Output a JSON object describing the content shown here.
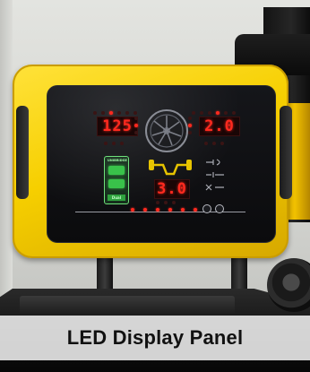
{
  "panel": {
    "readout_left": "125",
    "readout_right": "2.0",
    "readout_lower": "3.0",
    "module_top_label": "UNIBRIDGE",
    "module_bottom_label": "Dual"
  },
  "caption": {
    "text": "LED Display Panel"
  },
  "colors": {
    "housing": "#f6cf00",
    "screen": "#0b0b0d",
    "led_red": "#ff2a1f",
    "led_green": "#39c24a"
  },
  "icons": {
    "wheel": "wheel-rim-icon",
    "axle": "axle-icon",
    "module": "green-balancer-module-icon"
  }
}
